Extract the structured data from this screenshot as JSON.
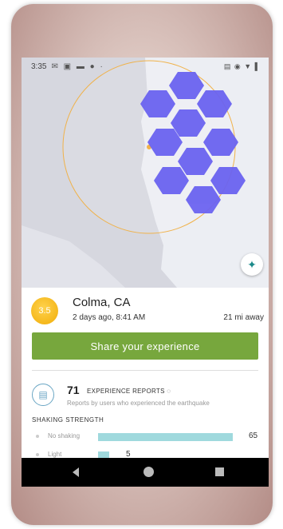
{
  "status_bar": {
    "time": "3:35",
    "left_icons": "✉ ▣ ▬ ● ·",
    "right_icons": "▤ ◉ ▼ ▌"
  },
  "map": {
    "radius_ring_color": "#f0b24a",
    "hexagon_color": "#6b63f0",
    "land_color": "#e7e8ee",
    "water_color": "#d3d4dc"
  },
  "earthquake": {
    "magnitude": "3.5",
    "location": "Colma, CA",
    "time_ago": "2 days ago, 8:41 AM",
    "distance": "21 mi away"
  },
  "share_button_label": "Share your experience",
  "reports": {
    "count": "71",
    "label": "EXPERIENCE REPORTS ◌",
    "subtitle": "Reports by users who experienced the earthquake"
  },
  "shaking": {
    "title": "SHAKING STRENGTH",
    "rows": [
      {
        "label": "No shaking",
        "count": "65",
        "fraction": 1.0
      },
      {
        "label": "Light",
        "count": "5",
        "fraction": 0.08
      }
    ]
  },
  "colors": {
    "accent_green": "#77a73d",
    "magnitude_yellow": "#f5b81c",
    "bar_teal": "#9fd9dd"
  }
}
